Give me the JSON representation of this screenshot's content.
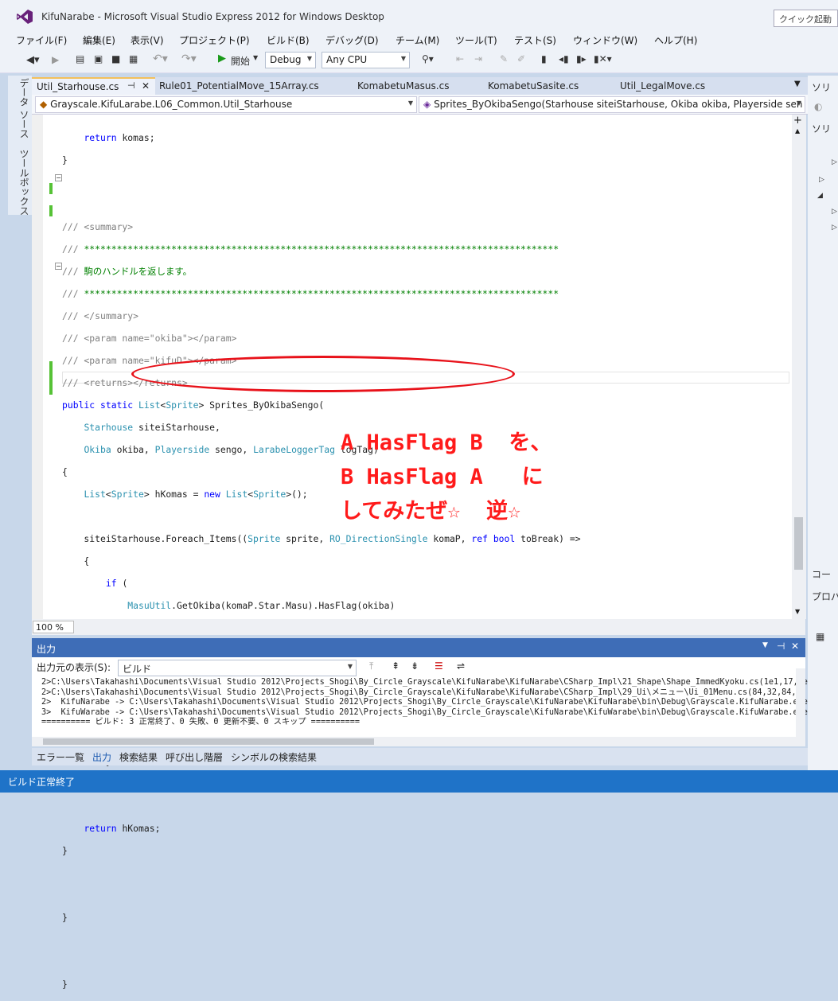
{
  "window": {
    "title": "KifuNarabe - Microsoft Visual Studio Express 2012 for Windows Desktop",
    "quick_launch": "クイック起動"
  },
  "menu": [
    "ファイル(F)",
    "編集(E)",
    "表示(V)",
    "プロジェクト(P)",
    "ビルド(B)",
    "デバッグ(D)",
    "チーム(M)",
    "ツール(T)",
    "テスト(S)",
    "ウィンドウ(W)",
    "ヘルプ(H)"
  ],
  "toolbar": {
    "start_label": "開始",
    "config": "Debug",
    "platform": "Any CPU"
  },
  "left_side_tabs": [
    "データ ソース",
    "ツールボックス"
  ],
  "tabs": [
    "Util_Starhouse.cs",
    "Rule01_PotentialMove_15Array.cs",
    "KomabetuMasus.cs",
    "KomabetuSasite.cs",
    "Util_LegalMove.cs"
  ],
  "nav": {
    "scope": "Grayscale.KifuLarabe.L06_Common.Util_Starhouse",
    "member": "Sprites_ByOkibaSengo(Starhouse siteiStarhouse, Okiba okiba, Playerside sen"
  },
  "editor": {
    "zoom": "100 %"
  },
  "annotation": {
    "line1": "A HasFlag B  を、",
    "line2": "B HasFlag A   に",
    "line3": "してみたぜ☆  逆☆"
  },
  "output": {
    "title": "出力",
    "source_label": "出力元の表示(S):",
    "source_value": "ビルド",
    "lines": [
      "2>C:\\Users\\Takahashi\\Documents\\Visual Studio 2012\\Projects_Shogi\\By_Circle_Grayscale\\KifuNarabe\\KifuNarabe\\CSharp_Impl\\21_Shape\\Shape_ImmedKyoku.cs(1e1,17,1e1,",
      "2>C:\\Users\\Takahashi\\Documents\\Visual Studio 2012\\Projects_Shogi\\By_Circle_Grayscale\\KifuNarabe\\KifuNarabe\\CSharp_Impl\\29_Ui\\メニュー\\Ui_01Menu.cs(84,32,84,5",
      "2>  KifuNarabe -> C:\\Users\\Takahashi\\Documents\\Visual Studio 2012\\Projects_Shogi\\By_Circle_Grayscale\\KifuNarabe\\KifuNarabe\\bin\\Debug\\Grayscale.KifuNarabe.exe",
      "3>  KifuWarabe -> C:\\Users\\Takahashi\\Documents\\Visual Studio 2012\\Projects_Shogi\\By_Circle_Grayscale\\KifuNarabe\\KifuWarabe\\bin\\Debug\\Grayscale.KifuWarabe.exe",
      "========== ビルド: 3 正常終了、0 失敗、0 更新不要、0 スキップ =========="
    ]
  },
  "bottom_tabs": [
    "エラー一覧",
    "出力",
    "検索結果",
    "呼び出し階層",
    "シンボルの検索結果"
  ],
  "status": "ビルド正常終了",
  "right_panel": {
    "top": "ソリ",
    "search": "ソリ",
    "code": "コー",
    "props": "プロパ"
  },
  "colors": {
    "accent": "#3e6db7",
    "status": "#1f73c8",
    "annotation": "#ff1a1a"
  }
}
